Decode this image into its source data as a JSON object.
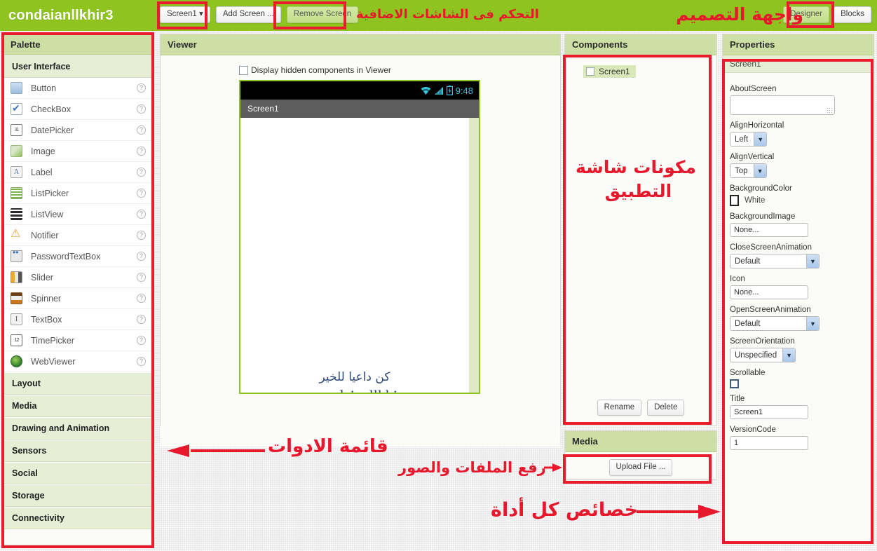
{
  "topbar": {
    "app_title": "condaianllkhir3",
    "screen_selector": "Screen1 ▾",
    "add_screen": "Add Screen ...",
    "remove_screen": "Remove Screen",
    "designer": "Designer",
    "blocks": "Blocks",
    "green": "#8ec320"
  },
  "annotations": {
    "screens_control": "التحكم فى الشاشات الاضافية",
    "design_interface": "واجهة التصميم",
    "screen_components": "مكونات شاشة\nالتطبيق",
    "screen_components_l1": "مكونات شاشة",
    "screen_components_l2": "التطبيق",
    "tools_list": "قائمة الادوات",
    "upload_files": "رفع الملفات والصور",
    "tool_properties": "خصائص كل أداة",
    "color": "#e8182c"
  },
  "palette": {
    "title": "Palette",
    "open_category": "User Interface",
    "items": [
      {
        "label": "Button",
        "icon": "button-icon"
      },
      {
        "label": "CheckBox",
        "icon": "checkbox-icon"
      },
      {
        "label": "DatePicker",
        "icon": "datepicker-icon"
      },
      {
        "label": "Image",
        "icon": "image-icon"
      },
      {
        "label": "Label",
        "icon": "label-icon"
      },
      {
        "label": "ListPicker",
        "icon": "listpicker-icon"
      },
      {
        "label": "ListView",
        "icon": "listview-icon"
      },
      {
        "label": "Notifier",
        "icon": "notifier-icon"
      },
      {
        "label": "PasswordTextBox",
        "icon": "passwordtextbox-icon"
      },
      {
        "label": "Slider",
        "icon": "slider-icon"
      },
      {
        "label": "Spinner",
        "icon": "spinner-icon"
      },
      {
        "label": "TextBox",
        "icon": "textbox-icon"
      },
      {
        "label": "TimePicker",
        "icon": "timepicker-icon"
      },
      {
        "label": "WebViewer",
        "icon": "webviewer-icon"
      }
    ],
    "help_glyph": "?",
    "categories": [
      "Layout",
      "Media",
      "Drawing and Animation",
      "Sensors",
      "Social",
      "Storage",
      "Connectivity"
    ]
  },
  "viewer": {
    "title": "Viewer",
    "hidden_components_label": "Display hidden components in Viewer",
    "hidden_components_checked": false,
    "phone": {
      "status_time": "9:48",
      "wifi_icon": "wifi-icon",
      "signal_icon": "cellular-signal-icon",
      "battery_icon": "battery-charging-icon",
      "title": "Screen1",
      "watermark_arabic": "كن داعيا للخير",
      "watermark_url": "www.condaianllkhir.com"
    }
  },
  "components": {
    "title": "Components",
    "tree": [
      {
        "label": "Screen1",
        "selected": true
      }
    ],
    "rename_label": "Rename",
    "delete_label": "Delete"
  },
  "media": {
    "title": "Media",
    "upload_label": "Upload File ..."
  },
  "properties": {
    "title": "Properties",
    "selected_component": "Screen1",
    "items": [
      {
        "name": "AboutScreen",
        "type": "textarea",
        "value": ""
      },
      {
        "name": "AlignHorizontal",
        "type": "select",
        "value": "Left"
      },
      {
        "name": "AlignVertical",
        "type": "select",
        "value": "Top"
      },
      {
        "name": "BackgroundColor",
        "type": "color",
        "value": "White"
      },
      {
        "name": "BackgroundImage",
        "type": "text",
        "value": "None..."
      },
      {
        "name": "CloseScreenAnimation",
        "type": "select",
        "value": "Default"
      },
      {
        "name": "Icon",
        "type": "text",
        "value": "None..."
      },
      {
        "name": "OpenScreenAnimation",
        "type": "select",
        "value": "Default"
      },
      {
        "name": "ScreenOrientation",
        "type": "select",
        "value": "Unspecified"
      },
      {
        "name": "Scrollable",
        "type": "checkbox",
        "value": ""
      },
      {
        "name": "Title",
        "type": "text",
        "value": "Screen1"
      },
      {
        "name": "VersionCode",
        "type": "text",
        "value": "1"
      }
    ]
  }
}
